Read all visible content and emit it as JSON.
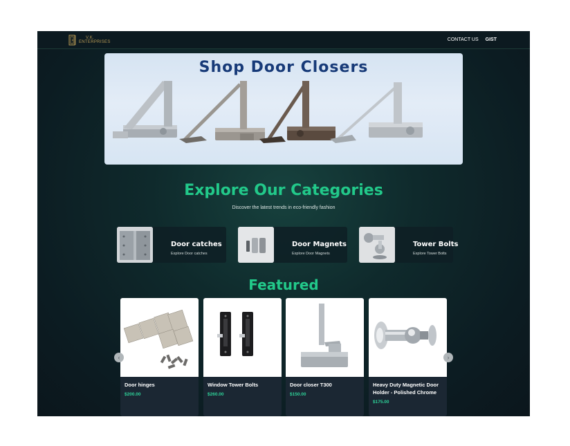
{
  "brand": {
    "logo_line1": "V.K.",
    "logo_line2": "ENTERPRISES"
  },
  "nav": {
    "links": [
      {
        "label": "CONTACT US"
      },
      {
        "label": "GIST"
      }
    ]
  },
  "hero": {
    "title": "Shop Door Closers"
  },
  "categories": {
    "title": "Explore Our Categories",
    "subtitle": "Discover the latest trends in eco-friendly fashion",
    "items": [
      {
        "name": "Door catches",
        "link": "Explore Door catches"
      },
      {
        "name": "Door Magnets",
        "link": "Explore Door Magnets"
      },
      {
        "name": "Tower Bolts",
        "link": "Explore Tower Bolts"
      }
    ]
  },
  "featured": {
    "title": "Featured",
    "products": [
      {
        "name": "Door hinges",
        "price": "$200.00"
      },
      {
        "name": "Window Tower Bolts",
        "price": "$260.00"
      },
      {
        "name": "Door closer T300",
        "price": "$150.00"
      },
      {
        "name": "Heavy Duty Magnetic Door Holder - Polished Chrome",
        "price": "$175.00"
      }
    ]
  },
  "colors": {
    "accent": "#22c98a",
    "price": "#2ed198",
    "nav_bg": "#0c1a20",
    "card_bg": "#1b2733"
  }
}
